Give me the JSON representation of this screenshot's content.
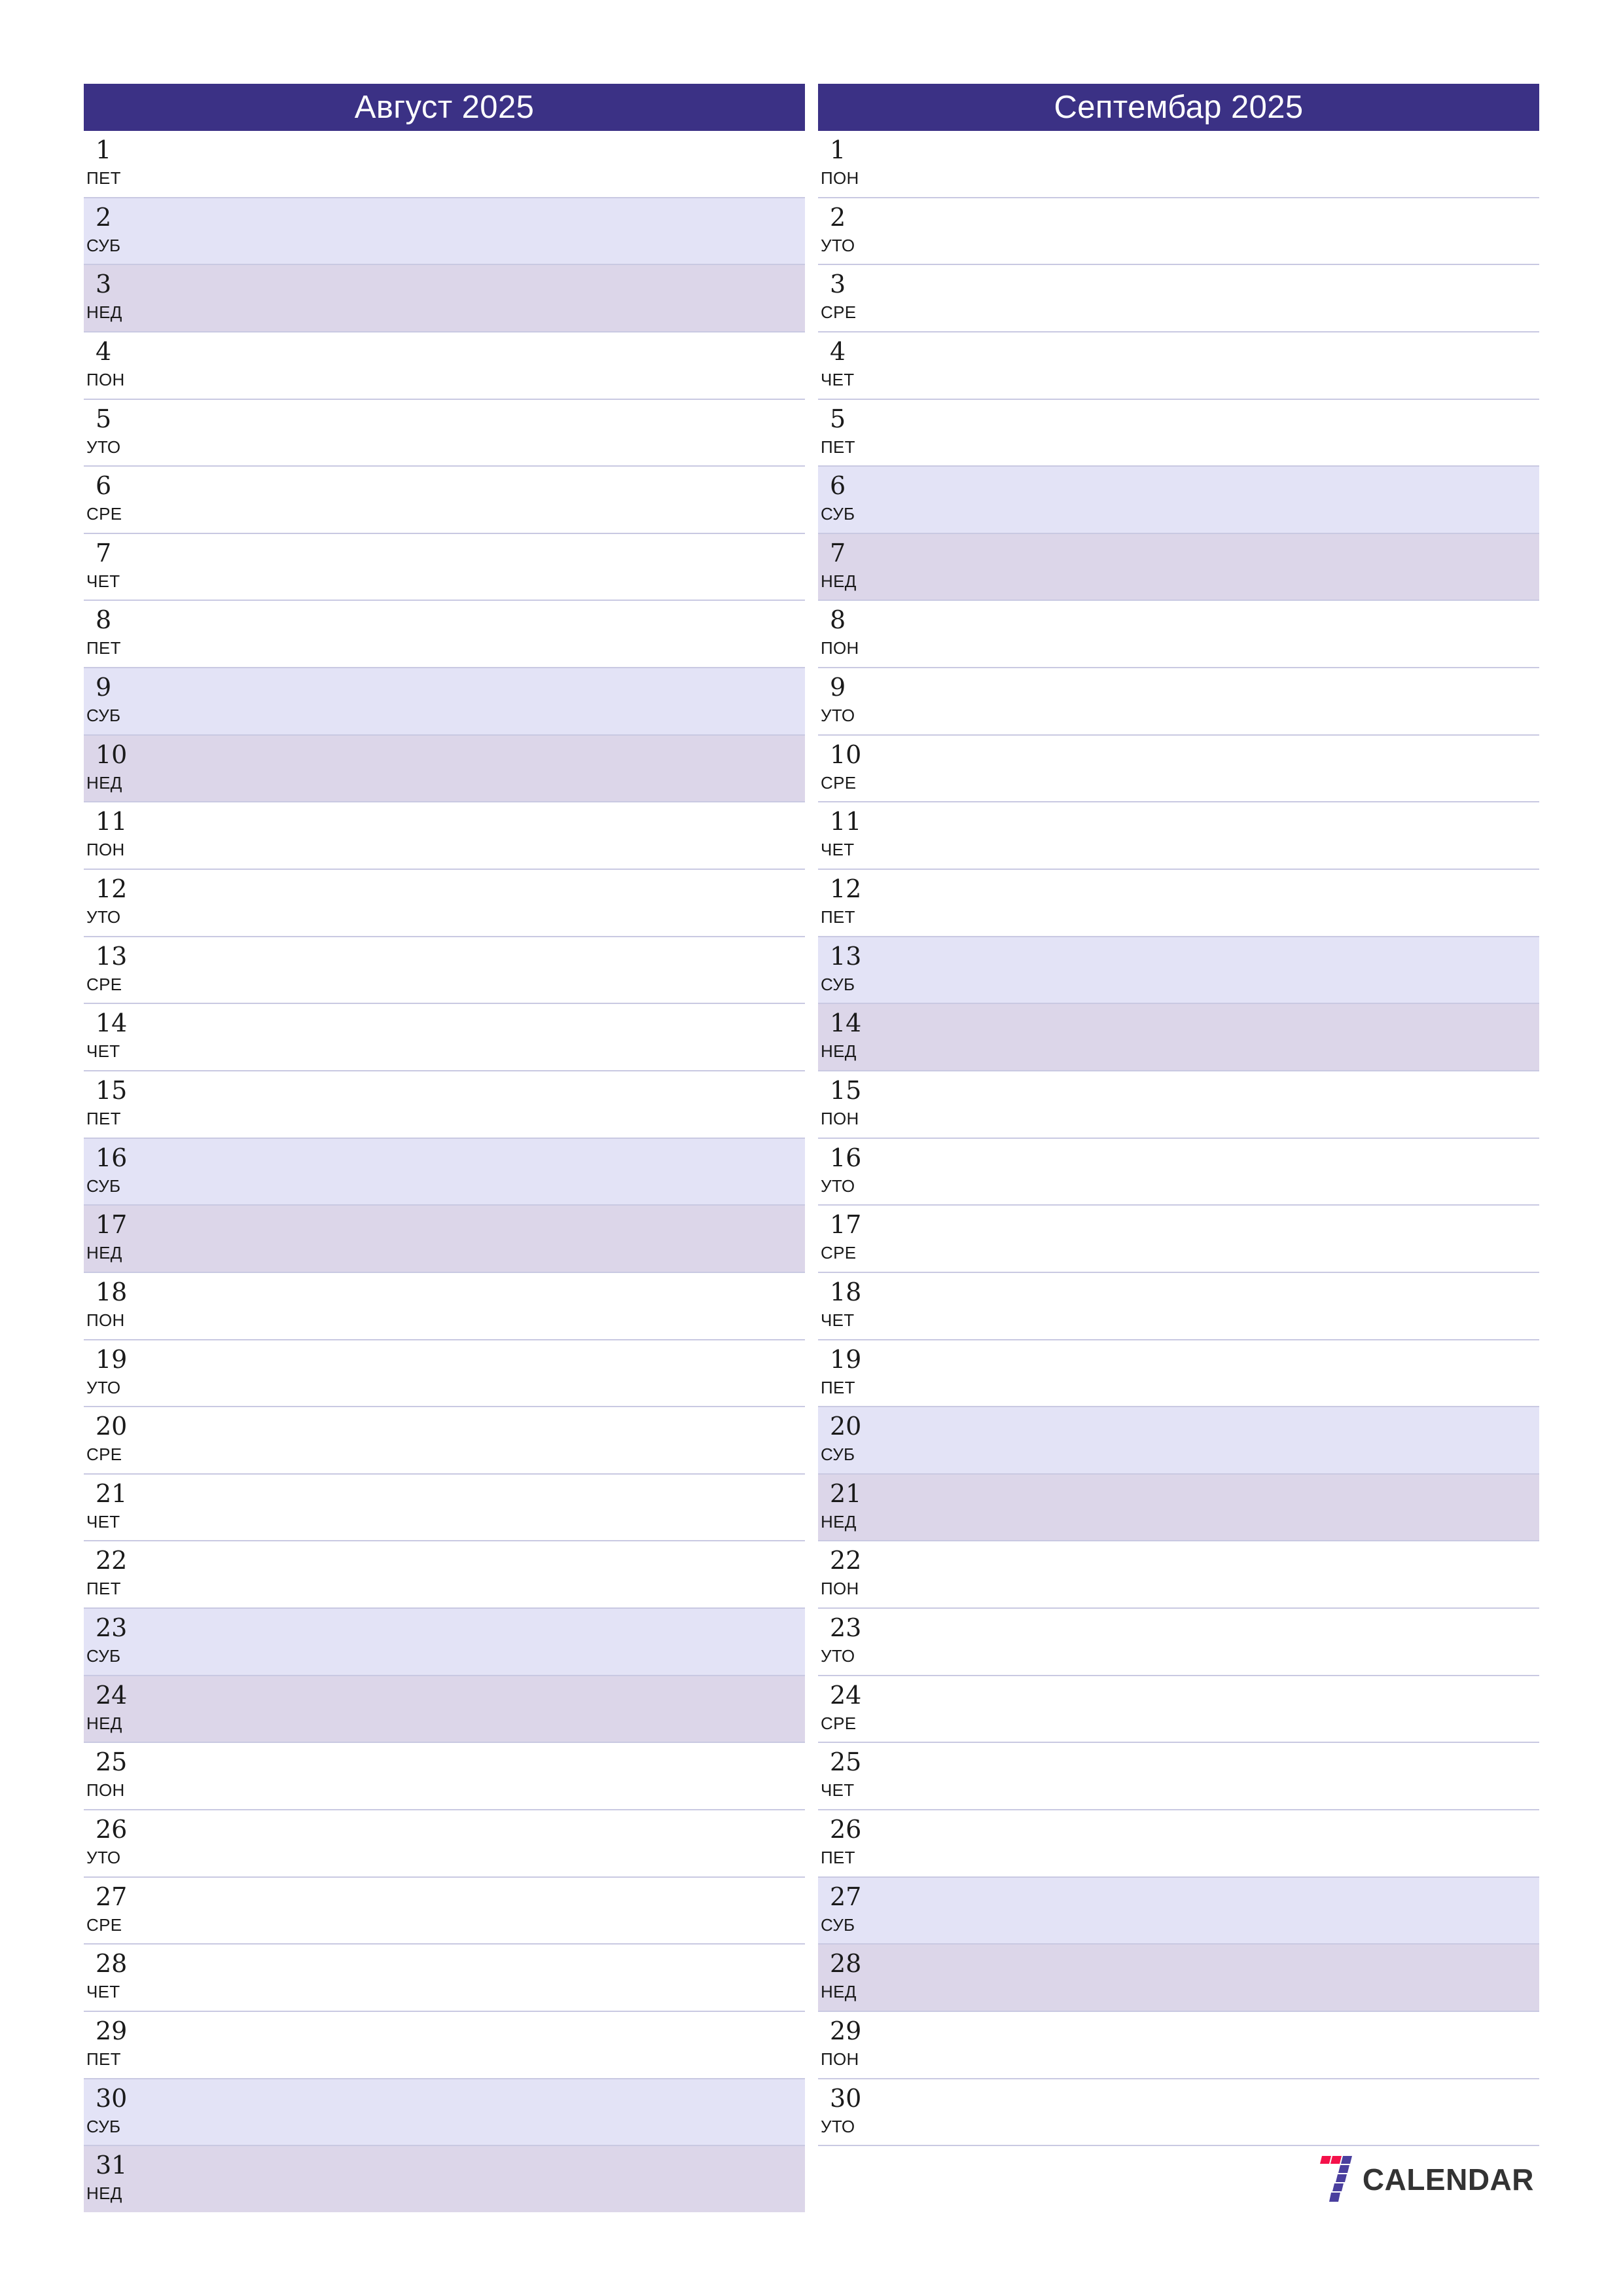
{
  "document": {
    "type": "two-month-planner",
    "orientation": "portrait",
    "language": "sr"
  },
  "colors": {
    "header_bg": "#3b3185",
    "header_text": "#ffffff",
    "saturday_bg": "#e3e3f6",
    "sunday_bg": "#dcd6e9",
    "row_border": "#c9c9e2",
    "text": "#1a1a1a",
    "logo_red": "#f4114a",
    "logo_purple": "#4a3f9e",
    "logo_word": "#333333"
  },
  "months": [
    {
      "title": "Август 2025",
      "name": "Август",
      "year": "2025",
      "days": [
        {
          "num": "1",
          "weekday": "ПЕТ",
          "type": "weekday"
        },
        {
          "num": "2",
          "weekday": "СУБ",
          "type": "saturday"
        },
        {
          "num": "3",
          "weekday": "НЕД",
          "type": "sunday"
        },
        {
          "num": "4",
          "weekday": "ПОН",
          "type": "weekday"
        },
        {
          "num": "5",
          "weekday": "УТО",
          "type": "weekday"
        },
        {
          "num": "6",
          "weekday": "СРЕ",
          "type": "weekday"
        },
        {
          "num": "7",
          "weekday": "ЧЕТ",
          "type": "weekday"
        },
        {
          "num": "8",
          "weekday": "ПЕТ",
          "type": "weekday"
        },
        {
          "num": "9",
          "weekday": "СУБ",
          "type": "saturday"
        },
        {
          "num": "10",
          "weekday": "НЕД",
          "type": "sunday"
        },
        {
          "num": "11",
          "weekday": "ПОН",
          "type": "weekday"
        },
        {
          "num": "12",
          "weekday": "УТО",
          "type": "weekday"
        },
        {
          "num": "13",
          "weekday": "СРЕ",
          "type": "weekday"
        },
        {
          "num": "14",
          "weekday": "ЧЕТ",
          "type": "weekday"
        },
        {
          "num": "15",
          "weekday": "ПЕТ",
          "type": "weekday"
        },
        {
          "num": "16",
          "weekday": "СУБ",
          "type": "saturday"
        },
        {
          "num": "17",
          "weekday": "НЕД",
          "type": "sunday"
        },
        {
          "num": "18",
          "weekday": "ПОН",
          "type": "weekday"
        },
        {
          "num": "19",
          "weekday": "УТО",
          "type": "weekday"
        },
        {
          "num": "20",
          "weekday": "СРЕ",
          "type": "weekday"
        },
        {
          "num": "21",
          "weekday": "ЧЕТ",
          "type": "weekday"
        },
        {
          "num": "22",
          "weekday": "ПЕТ",
          "type": "weekday"
        },
        {
          "num": "23",
          "weekday": "СУБ",
          "type": "saturday"
        },
        {
          "num": "24",
          "weekday": "НЕД",
          "type": "sunday"
        },
        {
          "num": "25",
          "weekday": "ПОН",
          "type": "weekday"
        },
        {
          "num": "26",
          "weekday": "УТО",
          "type": "weekday"
        },
        {
          "num": "27",
          "weekday": "СРЕ",
          "type": "weekday"
        },
        {
          "num": "28",
          "weekday": "ЧЕТ",
          "type": "weekday"
        },
        {
          "num": "29",
          "weekday": "ПЕТ",
          "type": "weekday"
        },
        {
          "num": "30",
          "weekday": "СУБ",
          "type": "saturday"
        },
        {
          "num": "31",
          "weekday": "НЕД",
          "type": "sunday"
        }
      ],
      "trailing_blank_rows": 0,
      "has_logo": false
    },
    {
      "title": "Септембар 2025",
      "name": "Септембар",
      "year": "2025",
      "days": [
        {
          "num": "1",
          "weekday": "ПОН",
          "type": "weekday"
        },
        {
          "num": "2",
          "weekday": "УТО",
          "type": "weekday"
        },
        {
          "num": "3",
          "weekday": "СРЕ",
          "type": "weekday"
        },
        {
          "num": "4",
          "weekday": "ЧЕТ",
          "type": "weekday"
        },
        {
          "num": "5",
          "weekday": "ПЕТ",
          "type": "weekday"
        },
        {
          "num": "6",
          "weekday": "СУБ",
          "type": "saturday"
        },
        {
          "num": "7",
          "weekday": "НЕД",
          "type": "sunday"
        },
        {
          "num": "8",
          "weekday": "ПОН",
          "type": "weekday"
        },
        {
          "num": "9",
          "weekday": "УТО",
          "type": "weekday"
        },
        {
          "num": "10",
          "weekday": "СРЕ",
          "type": "weekday"
        },
        {
          "num": "11",
          "weekday": "ЧЕТ",
          "type": "weekday"
        },
        {
          "num": "12",
          "weekday": "ПЕТ",
          "type": "weekday"
        },
        {
          "num": "13",
          "weekday": "СУБ",
          "type": "saturday"
        },
        {
          "num": "14",
          "weekday": "НЕД",
          "type": "sunday"
        },
        {
          "num": "15",
          "weekday": "ПОН",
          "type": "weekday"
        },
        {
          "num": "16",
          "weekday": "УТО",
          "type": "weekday"
        },
        {
          "num": "17",
          "weekday": "СРЕ",
          "type": "weekday"
        },
        {
          "num": "18",
          "weekday": "ЧЕТ",
          "type": "weekday"
        },
        {
          "num": "19",
          "weekday": "ПЕТ",
          "type": "weekday"
        },
        {
          "num": "20",
          "weekday": "СУБ",
          "type": "saturday"
        },
        {
          "num": "21",
          "weekday": "НЕД",
          "type": "sunday"
        },
        {
          "num": "22",
          "weekday": "ПОН",
          "type": "weekday"
        },
        {
          "num": "23",
          "weekday": "УТО",
          "type": "weekday"
        },
        {
          "num": "24",
          "weekday": "СРЕ",
          "type": "weekday"
        },
        {
          "num": "25",
          "weekday": "ЧЕТ",
          "type": "weekday"
        },
        {
          "num": "26",
          "weekday": "ПЕТ",
          "type": "weekday"
        },
        {
          "num": "27",
          "weekday": "СУБ",
          "type": "saturday"
        },
        {
          "num": "28",
          "weekday": "НЕД",
          "type": "sunday"
        },
        {
          "num": "29",
          "weekday": "ПОН",
          "type": "weekday"
        },
        {
          "num": "30",
          "weekday": "УТО",
          "type": "weekday"
        }
      ],
      "trailing_blank_rows": 1,
      "has_logo": true
    }
  ],
  "branding": {
    "wordmark": "CALENDAR",
    "mark_name": "seven-logo-icon"
  }
}
